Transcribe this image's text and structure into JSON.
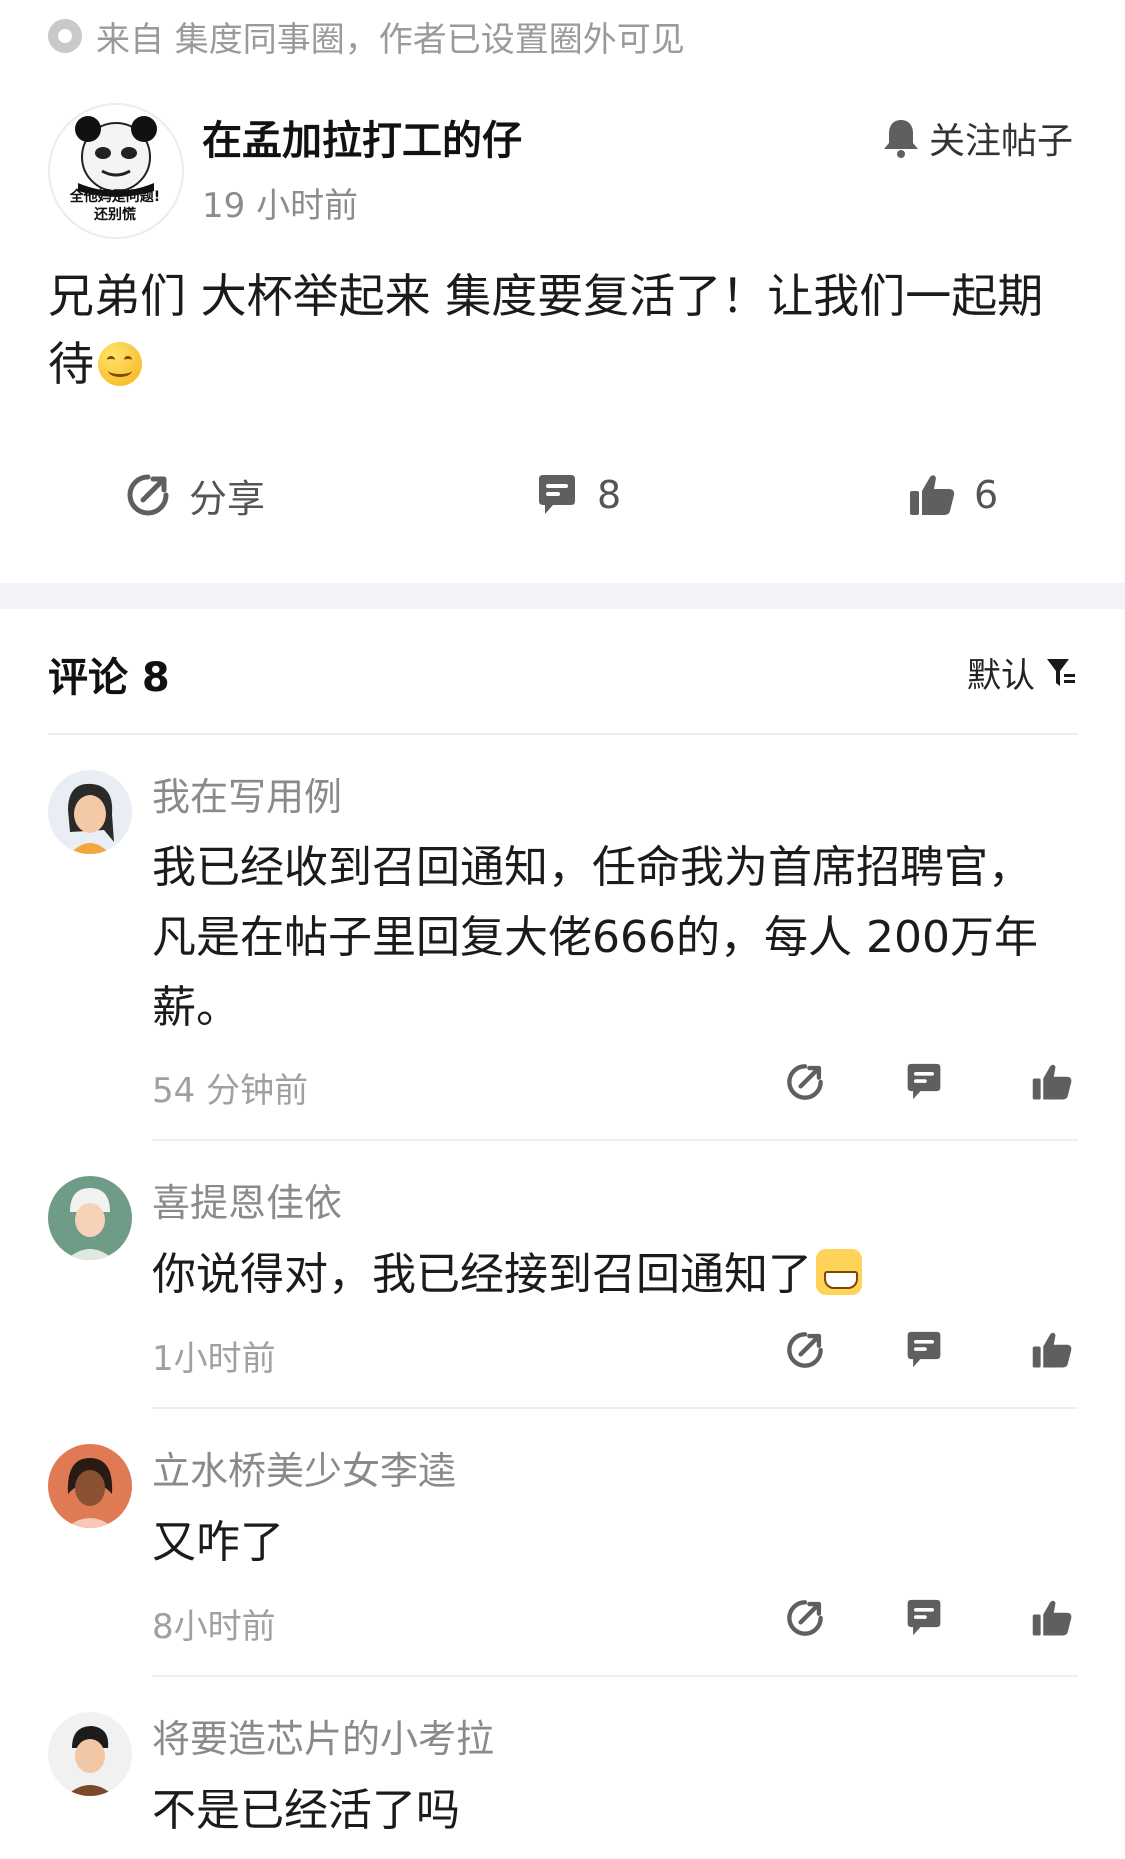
{
  "source_line": "来自 集度同事圈，作者已设置圈外可见",
  "post": {
    "author": "在孟加拉打工的仔",
    "avatar_caption_1": "全他妈是问题!",
    "avatar_caption_2": "还别慌",
    "time": "19 小时前",
    "follow_label": "关注帖子",
    "body": "兄弟们 大杯举起来 集度要复活了！让我们一起期待",
    "body_emoji": "smiling-face-emoji",
    "share_label": "分享",
    "comment_count": "8",
    "like_count": "6"
  },
  "comments_section": {
    "title": "评论 8",
    "sort_label": "默认"
  },
  "comments": [
    {
      "name": "我在写用例",
      "text": "我已经收到召回通知，任命我为首席招聘官，凡是在帖子里回复大佬666的，每人 200万年薪。",
      "time": "54 分钟前",
      "avatar_color": "#2a2a2a"
    },
    {
      "name": "喜提恩佳依",
      "text": "你说得对，我已经接到召回通知了",
      "text_emoji": "grinning-face-emoji",
      "time": "1小时前",
      "avatar_color": "#6e9c86"
    },
    {
      "name": "立水桥美少女李逵",
      "text": "又咋了",
      "time": "8小时前",
      "avatar_color": "#e07a55"
    },
    {
      "name": "将要造芯片的小考拉",
      "text": "不是已经活了吗",
      "time": "",
      "avatar_color": "#f1f1f1"
    }
  ],
  "colors": {
    "text_primary": "#1b1b1b",
    "text_secondary": "#8a8a8a",
    "icon": "#5f5f5f",
    "section_band": "#f2f3f6"
  }
}
